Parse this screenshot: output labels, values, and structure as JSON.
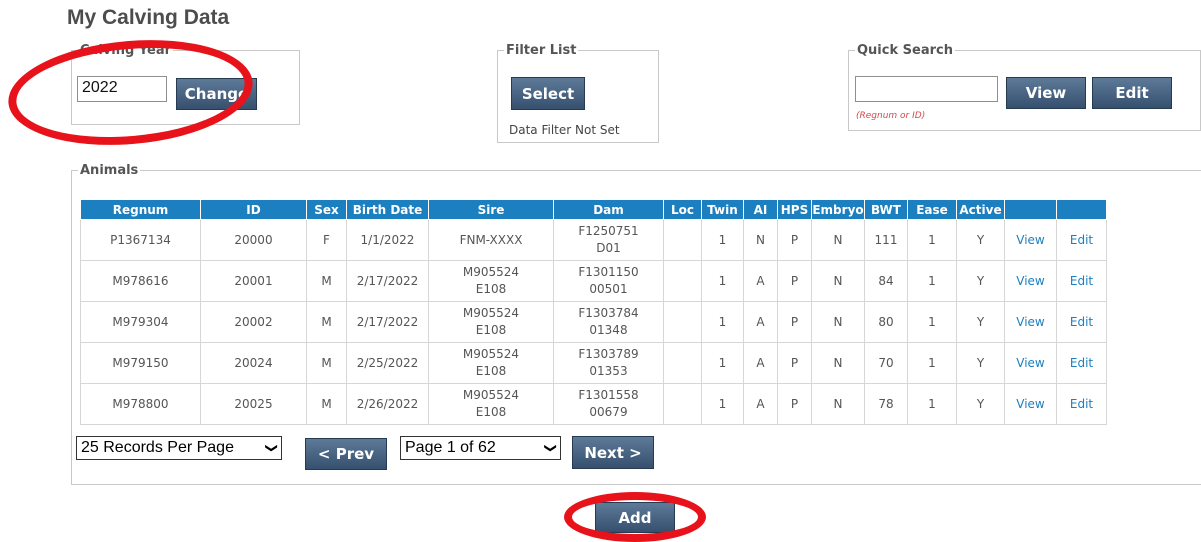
{
  "page": {
    "title": "My Calving Data"
  },
  "calving_year": {
    "legend": "Calving Year",
    "value": "2022",
    "change_label": "Change"
  },
  "filter_list": {
    "legend": "Filter List",
    "select_label": "Select",
    "status": "Data Filter Not Set"
  },
  "quick_search": {
    "legend": "Quick Search",
    "value": "",
    "view_label": "View",
    "edit_label": "Edit",
    "hint": "(Regnum or ID)"
  },
  "animals": {
    "legend": "Animals",
    "columns": [
      "Regnum",
      "ID",
      "Sex",
      "Birth Date",
      "Sire",
      "Dam",
      "Loc",
      "Twin",
      "AI",
      "HPS",
      "Embryo",
      "BWT",
      "Ease",
      "Active",
      "",
      ""
    ],
    "rows": [
      {
        "regnum": "P1367134",
        "id": "20000",
        "sex": "F",
        "birth_date": "1/1/2022",
        "sire_1": "FNM-XXXX",
        "sire_2": "",
        "dam_1": "F1250751",
        "dam_2": "D01",
        "loc": "",
        "twin": "1",
        "ai": "N",
        "hps": "P",
        "embryo": "N",
        "bwt": "111",
        "ease": "1",
        "active": "Y",
        "view": "View",
        "edit": "Edit"
      },
      {
        "regnum": "M978616",
        "id": "20001",
        "sex": "M",
        "birth_date": "2/17/2022",
        "sire_1": "M905524",
        "sire_2": "E108",
        "dam_1": "F1301150",
        "dam_2": "00501",
        "loc": "",
        "twin": "1",
        "ai": "A",
        "hps": "P",
        "embryo": "N",
        "bwt": "84",
        "ease": "1",
        "active": "Y",
        "view": "View",
        "edit": "Edit"
      },
      {
        "regnum": "M979304",
        "id": "20002",
        "sex": "M",
        "birth_date": "2/17/2022",
        "sire_1": "M905524",
        "sire_2": "E108",
        "dam_1": "F1303784",
        "dam_2": "01348",
        "loc": "",
        "twin": "1",
        "ai": "A",
        "hps": "P",
        "embryo": "N",
        "bwt": "80",
        "ease": "1",
        "active": "Y",
        "view": "View",
        "edit": "Edit"
      },
      {
        "regnum": "M979150",
        "id": "20024",
        "sex": "M",
        "birth_date": "2/25/2022",
        "sire_1": "M905524",
        "sire_2": "E108",
        "dam_1": "F1303789",
        "dam_2": "01353",
        "loc": "",
        "twin": "1",
        "ai": "A",
        "hps": "P",
        "embryo": "N",
        "bwt": "70",
        "ease": "1",
        "active": "Y",
        "view": "View",
        "edit": "Edit"
      },
      {
        "regnum": "M978800",
        "id": "20025",
        "sex": "M",
        "birth_date": "2/26/2022",
        "sire_1": "M905524",
        "sire_2": "E108",
        "dam_1": "F1301558",
        "dam_2": "00679",
        "loc": "",
        "twin": "1",
        "ai": "A",
        "hps": "P",
        "embryo": "N",
        "bwt": "78",
        "ease": "1",
        "active": "Y",
        "view": "View",
        "edit": "Edit"
      }
    ]
  },
  "pager": {
    "per_page": "25 Records Per Page",
    "prev_label": "< Prev",
    "page": "Page 1 of 62",
    "next_label": "Next >"
  },
  "actions": {
    "add_label": "Add"
  },
  "colors": {
    "header_blue": "#1c7fbf",
    "button_navy": "#36506e",
    "annotation_red": "#e8121b",
    "link_blue": "#1c7fbf"
  }
}
